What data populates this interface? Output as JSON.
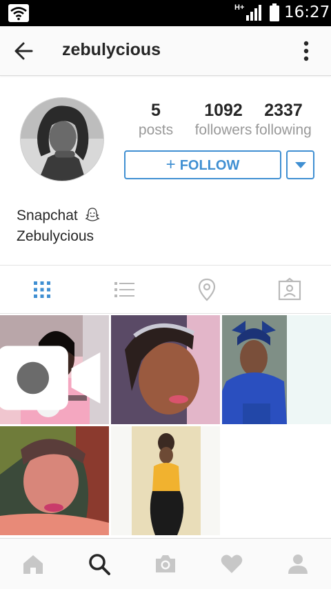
{
  "status_bar": {
    "network": "H+",
    "time": "16:27"
  },
  "header": {
    "username": "zebulycious"
  },
  "stats": {
    "posts_count": "5",
    "posts_label": "posts",
    "followers_count": "1092",
    "followers_label": "followers",
    "following_count": "2337",
    "following_label": "following"
  },
  "follow_button": {
    "plus": "+",
    "label": "FOLLOW"
  },
  "bio": {
    "line1": "Snapchat",
    "line2": "Zebulycious"
  },
  "tabs": [
    "grid-icon",
    "list-icon",
    "location-pin-icon",
    "tagged-photos-icon"
  ],
  "active_tab": "grid-icon",
  "colors": {
    "accent": "#3f8fd2",
    "text": "#262626",
    "muted": "#999999",
    "nav_inactive": "#c7c7c7",
    "nav_active": "#262626"
  },
  "posts": [
    {
      "name": "post-1",
      "video": true
    },
    {
      "name": "post-2",
      "video": false
    },
    {
      "name": "post-3",
      "video": false
    },
    {
      "name": "post-4",
      "video": false
    },
    {
      "name": "post-5",
      "video": false
    }
  ],
  "bottom_nav": [
    "home-icon",
    "search-icon",
    "camera-icon",
    "heart-icon",
    "profile-icon"
  ],
  "active_nav": "search-icon"
}
